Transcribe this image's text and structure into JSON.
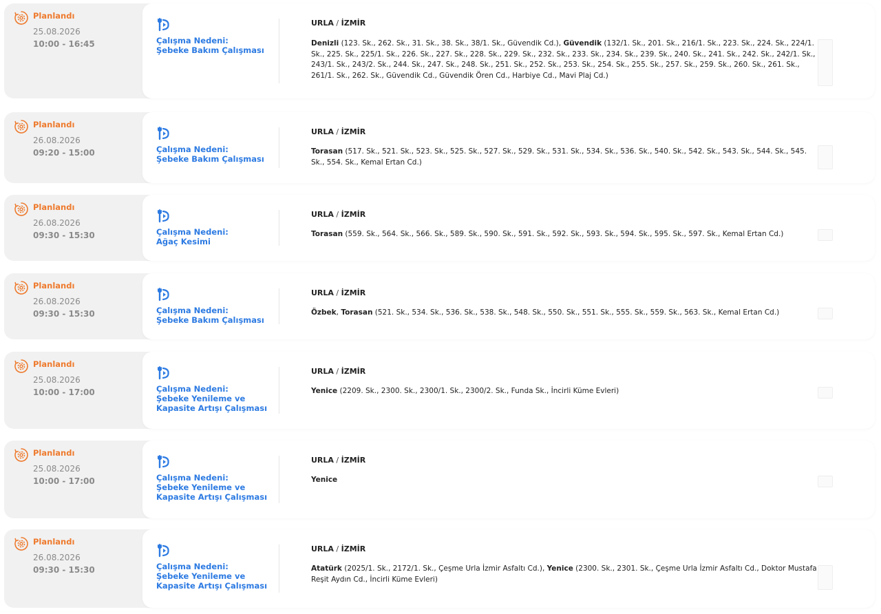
{
  "colors": {
    "status": "#ee7a2d",
    "reason": "#2c7ae2",
    "card_bg": "#f1f1f1",
    "panel_bg": "#ffffff"
  },
  "outages": [
    {
      "status": "Planlandı",
      "date": "25.08.2026",
      "time": "10:00 - 16:45",
      "reason_label": "Çalışma Nedeni:",
      "reason": "Şebeke Bakım Çalışması",
      "district": "URLA",
      "province": "İZMİR",
      "segments": [
        {
          "name": "Denizli",
          "detail": " (123. Sk., 262. Sk., 31. Sk., 38. Sk., 38/1. Sk., Güvendik Cd.), "
        },
        {
          "name": "Güvendik",
          "detail": " (132/1. Sk., 201. Sk., 216/1. Sk., 223. Sk., 224. Sk., 224/1. Sk., 225. Sk., 225/1. Sk., 226. Sk., 227. Sk., 228. Sk., 229. Sk., 232. Sk., 233. Sk., 234. Sk., 239. Sk., 240. Sk., 241. Sk., 242. Sk., 242/1. Sk., 243/1. Sk., 243/2. Sk., 244. Sk., 247. Sk., 248. Sk., 251. Sk., 252. Sk., 253. Sk., 254. Sk., 255. Sk., 257. Sk., 259. Sk., 260. Sk., 261. Sk., 261/1. Sk., 262. Sk., Güvendik Cd., Güvendik Ören Cd., Harbiye Cd., Mavi Plaj Cd.)"
        }
      ]
    },
    {
      "status": "Planlandı",
      "date": "26.08.2026",
      "time": "09:20 - 15:00",
      "reason_label": "Çalışma Nedeni:",
      "reason": "Şebeke Bakım Çalışması",
      "district": "URLA",
      "province": "İZMİR",
      "segments": [
        {
          "name": "Torasan",
          "detail": " (517. Sk., 521. Sk., 523. Sk., 525. Sk., 527. Sk., 529. Sk., 531. Sk., 534. Sk., 536. Sk., 540. Sk., 542. Sk., 543. Sk., 544. Sk., 545. Sk., 554. Sk., Kemal Ertan Cd.)"
        }
      ]
    },
    {
      "status": "Planlandı",
      "date": "26.08.2026",
      "time": "09:30 - 15:30",
      "reason_label": "Çalışma Nedeni:",
      "reason": "Ağaç Kesimi",
      "district": "URLA",
      "province": "İZMİR",
      "segments": [
        {
          "name": "Torasan",
          "detail": " (559. Sk., 564. Sk., 566. Sk., 589. Sk., 590. Sk., 591. Sk., 592. Sk., 593. Sk., 594. Sk., 595. Sk., 597. Sk., Kemal Ertan Cd.)"
        }
      ]
    },
    {
      "status": "Planlandı",
      "date": "26.08.2026",
      "time": "09:30 - 15:30",
      "reason_label": "Çalışma Nedeni:",
      "reason": "Şebeke Bakım Çalışması",
      "district": "URLA",
      "province": "İZMİR",
      "segments": [
        {
          "name": "Özbek",
          "detail": ", "
        },
        {
          "name": "Torasan",
          "detail": " (521. Sk., 534. Sk., 536. Sk., 538. Sk., 548. Sk., 550. Sk., 551. Sk., 555. Sk., 559. Sk., 563. Sk., Kemal Ertan Cd.)"
        }
      ]
    },
    {
      "status": "Planlandı",
      "date": "25.08.2026",
      "time": "10:00 - 17:00",
      "reason_label": "Çalışma Nedeni:",
      "reason": "Şebeke Yenileme ve Kapasite Artışı Çalışması",
      "district": "URLA",
      "province": "İZMİR",
      "segments": [
        {
          "name": "Yenice",
          "detail": " (2209. Sk., 2300. Sk., 2300/1. Sk., 2300/2. Sk., Funda Sk., İncirli Küme Evleri)"
        }
      ]
    },
    {
      "status": "Planlandı",
      "date": "25.08.2026",
      "time": "10:00 - 17:00",
      "reason_label": "Çalışma Nedeni:",
      "reason": "Şebeke Yenileme ve Kapasite Artışı Çalışması",
      "district": "URLA",
      "province": "İZMİR",
      "segments": [
        {
          "name": "Yenice",
          "detail": ""
        }
      ]
    },
    {
      "status": "Planlandı",
      "date": "26.08.2026",
      "time": "09:30 - 15:30",
      "reason_label": "Çalışma Nedeni:",
      "reason": "Şebeke Yenileme ve Kapasite Artışı Çalışması",
      "district": "URLA",
      "province": "İZMİR",
      "segments": [
        {
          "name": "Atatürk",
          "detail": " (2025/1. Sk., 2172/1. Sk., Çeşme Urla İzmir Asfaltı Cd.), "
        },
        {
          "name": "Yenice",
          "detail": " (2300. Sk., 2301. Sk., Çeşme Urla İzmir Asfaltı Cd., Doktor Mustafa Reşit Aydın Cd., İncirli Küme Evleri)"
        }
      ]
    }
  ]
}
